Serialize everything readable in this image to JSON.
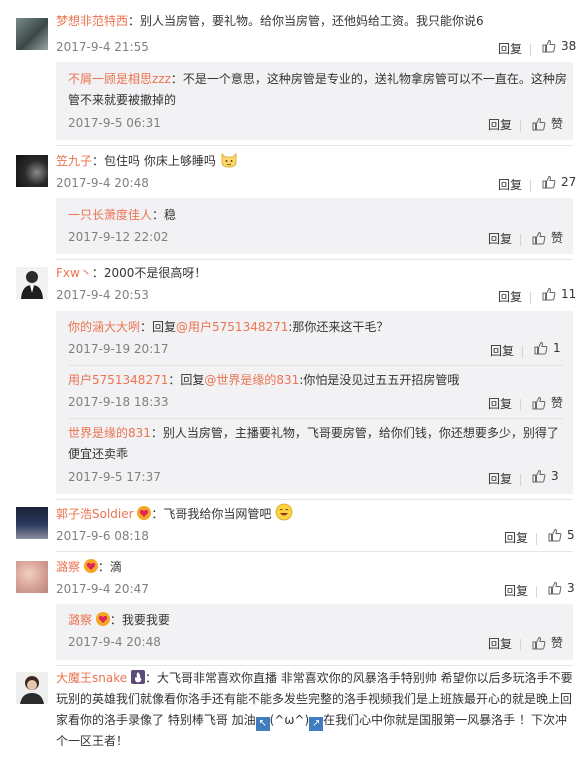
{
  "comments": [
    {
      "user": "梦想非范特西",
      "text": "：别人当房管，要礼物。给你当房管，还他妈给工资。我只能你说6",
      "time": "2017-9-4 21:55",
      "reply": "回复",
      "likes": "38",
      "subs": [
        {
          "user": "不屑一顾是相思zzz",
          "text1": "：不是一个意思，这种房管是专业的，送礼物拿房管可以不一直在。这种房",
          "text2": "管不来就要被撤掉的",
          "time": "2017-9-5 06:31",
          "reply": "回复",
          "likes": "赞"
        }
      ]
    },
    {
      "user": "笠九子",
      "text": "：包住吗 你床上够睡吗",
      "time": "2017-9-4 20:48",
      "reply": "回复",
      "likes": "27",
      "subs": [
        {
          "user": "一只长萧度佳人",
          "text": "：稳",
          "time": "2017-9-12 22:02",
          "reply": "回复",
          "likes": "赞"
        }
      ]
    },
    {
      "user": "Fxw丶",
      "text": "：2000不是很高呀！",
      "time": "2017-9-4 20:53",
      "reply": "回复",
      "likes": "11",
      "subs": [
        {
          "user": "你的涵大大咧",
          "pre": "：回复",
          "mention": "@用户5751348271",
          "post": ":那你还来这干毛？",
          "time": "2017-9-19 20:17",
          "reply": "回复",
          "likes": "1"
        },
        {
          "user": "用户5751348271",
          "pre": "：回复",
          "mention": "@世界是缘的831",
          "post": ":你怕是没见过五五开招房管哦",
          "time": "2017-9-18 18:33",
          "reply": "回复",
          "likes": "赞"
        },
        {
          "user": "世界是缘的831",
          "text1": "：别人当房管，主播要礼物，飞哥要房管，给你们钱，你还想要多少，别得了",
          "text2": "便宜还卖乖",
          "time": "2017-9-5 17:37",
          "reply": "回复",
          "likes": "3"
        }
      ]
    },
    {
      "user": "郭子浩Soldier",
      "text": "：飞哥我给你当网管吧",
      "time": "2017-9-6 08:18",
      "reply": "回复",
      "likes": "5",
      "subs": []
    },
    {
      "user": "潞察",
      "text": "：滴",
      "time": "2017-9-4 20:47",
      "reply": "回复",
      "likes": "3",
      "subs": [
        {
          "user": "潞察",
          "text": "：我要我要",
          "time": "2017-9-4 20:48",
          "reply": "回复",
          "likes": "赞"
        }
      ]
    },
    {
      "user": "大魔王snake",
      "line1": "：大飞哥非常喜欢你直播 非常喜欢你的风暴洛手特别帅 希望你以后多玩洛手不要",
      "line2": "玩别的英雄我们就像看你洛手还有能不能多发些完整的洛手视频我们是上班族最开心的就是晚上回",
      "line3a": "家看你的洛手录像了 特别棒飞哥 加油",
      "line3b": "(^ω^)",
      "line3c": "在我们心中你就是国服第一风暴洛手 ！下次冲",
      "line4": "个一区王者！"
    }
  ],
  "colors": {
    "username": "#eb7350",
    "subbox": "#f2f2f5",
    "meta": "#808080"
  }
}
